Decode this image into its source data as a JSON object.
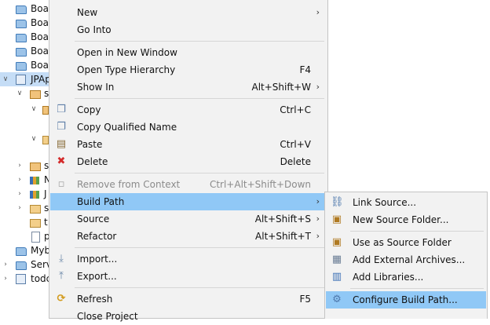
{
  "tree": {
    "rows": [
      {
        "label": "Boar"
      },
      {
        "label": "Boar"
      },
      {
        "label": "Boar"
      },
      {
        "label": "Boar"
      },
      {
        "label": "Boar"
      },
      {
        "label": "JPAp"
      },
      {
        "label": "s"
      },
      {
        "label": ""
      },
      {
        "label": ""
      },
      {
        "label": ""
      },
      {
        "label": "s"
      },
      {
        "label": "N"
      },
      {
        "label": "J"
      },
      {
        "label": "s"
      },
      {
        "label": "t"
      },
      {
        "label": "p"
      },
      {
        "label": "Myb"
      },
      {
        "label": "Serv"
      },
      {
        "label": "todc"
      }
    ]
  },
  "menu": {
    "new": {
      "label": "New"
    },
    "go_into": {
      "label": "Go Into"
    },
    "open_new_window": {
      "label": "Open in New Window"
    },
    "open_type_hierarchy": {
      "label": "Open Type Hierarchy",
      "accel": "F4"
    },
    "show_in": {
      "label": "Show In",
      "accel": "Alt+Shift+W"
    },
    "copy": {
      "label": "Copy",
      "accel": "Ctrl+C"
    },
    "copy_qualified": {
      "label": "Copy Qualified Name"
    },
    "paste": {
      "label": "Paste",
      "accel": "Ctrl+V"
    },
    "delete": {
      "label": "Delete",
      "accel": "Delete"
    },
    "remove_context": {
      "label": "Remove from Context",
      "accel": "Ctrl+Alt+Shift+Down"
    },
    "build_path": {
      "label": "Build Path"
    },
    "source": {
      "label": "Source",
      "accel": "Alt+Shift+S"
    },
    "refactor": {
      "label": "Refactor",
      "accel": "Alt+Shift+T"
    },
    "import": {
      "label": "Import..."
    },
    "export": {
      "label": "Export..."
    },
    "refresh": {
      "label": "Refresh",
      "accel": "F5"
    },
    "close_project": {
      "label": "Close Project"
    }
  },
  "submenu": {
    "link_source": {
      "label": "Link Source..."
    },
    "new_source_folder": {
      "label": "New Source Folder..."
    },
    "use_as_source": {
      "label": "Use as Source Folder"
    },
    "add_external_archives": {
      "label": "Add External Archives..."
    },
    "add_libraries": {
      "label": "Add Libraries..."
    },
    "configure_build_path": {
      "label": "Configure Build Path..."
    }
  },
  "glyphs": {
    "arrow": "›"
  }
}
